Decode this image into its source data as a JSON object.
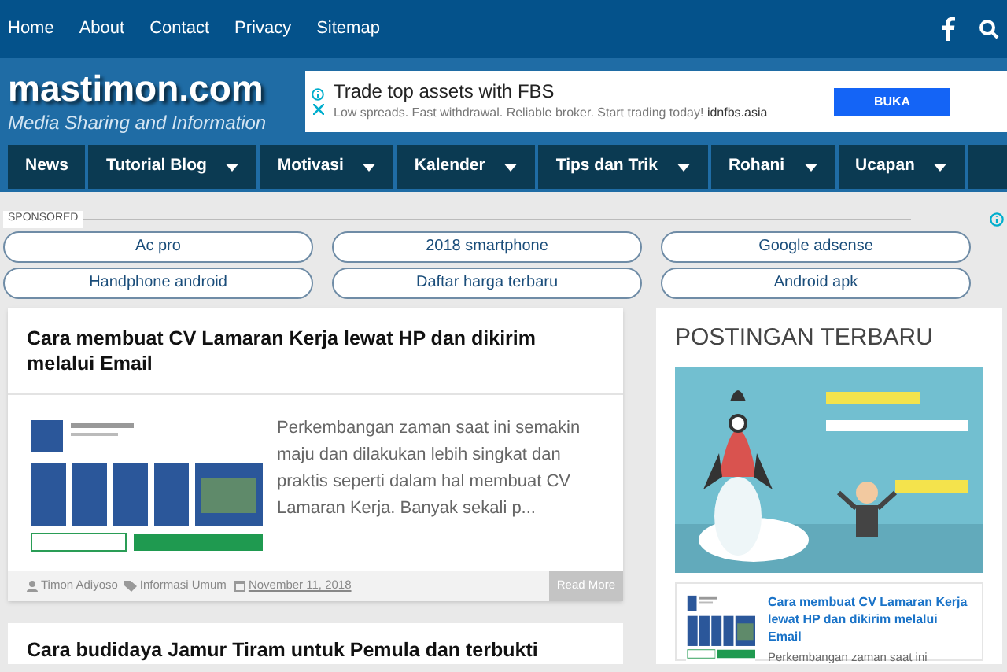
{
  "top_nav": {
    "links": [
      "Home",
      "About",
      "Contact",
      "Privacy",
      "Sitemap"
    ]
  },
  "header": {
    "site_title": "mastimon.com",
    "tagline": "Media Sharing and Information"
  },
  "ad_banner": {
    "headline": "Trade top assets with FBS",
    "text": "Low spreads. Fast withdrawal. Reliable broker. Start trading today!",
    "domain": "idnfbs.asia",
    "button": "BUKA"
  },
  "menu": [
    {
      "label": "News",
      "dropdown": false
    },
    {
      "label": "Tutorial Blog",
      "dropdown": true
    },
    {
      "label": "Motivasi",
      "dropdown": true
    },
    {
      "label": "Kalender",
      "dropdown": true
    },
    {
      "label": "Tips dan Trik",
      "dropdown": true
    },
    {
      "label": "Rohani",
      "dropdown": true
    },
    {
      "label": "Ucapan",
      "dropdown": true
    }
  ],
  "sponsored": {
    "label": "SPONSORED",
    "links": [
      "Ac pro",
      "2018 smartphone",
      "Google adsense",
      "Handphone android",
      "Daftar harga terbaru",
      "Android apk"
    ]
  },
  "posts": [
    {
      "title": "Cara membuat CV Lamaran Kerja lewat HP dan dikirim melalui Email",
      "excerpt": "Perkembangan zaman saat ini semakin maju dan dilakukan lebih singkat dan praktis seperti dalam hal membuat CV Lamaran Kerja. Banyak sekali p...",
      "author": "Timon Adiyoso",
      "category": "Informasi Umum",
      "date": "November 11, 2018",
      "read_more": "Read More"
    },
    {
      "title": "Cara budidaya Jamur Tiram untuk Pemula dan terbukti"
    }
  ],
  "sidebar": {
    "title": "POSTINGAN TERBARU",
    "recent": [
      {
        "title": "Cara membuat CV Lamaran Kerja lewat HP dan dikirim melalui Email",
        "excerpt": "Perkembangan zaman saat ini"
      }
    ]
  }
}
